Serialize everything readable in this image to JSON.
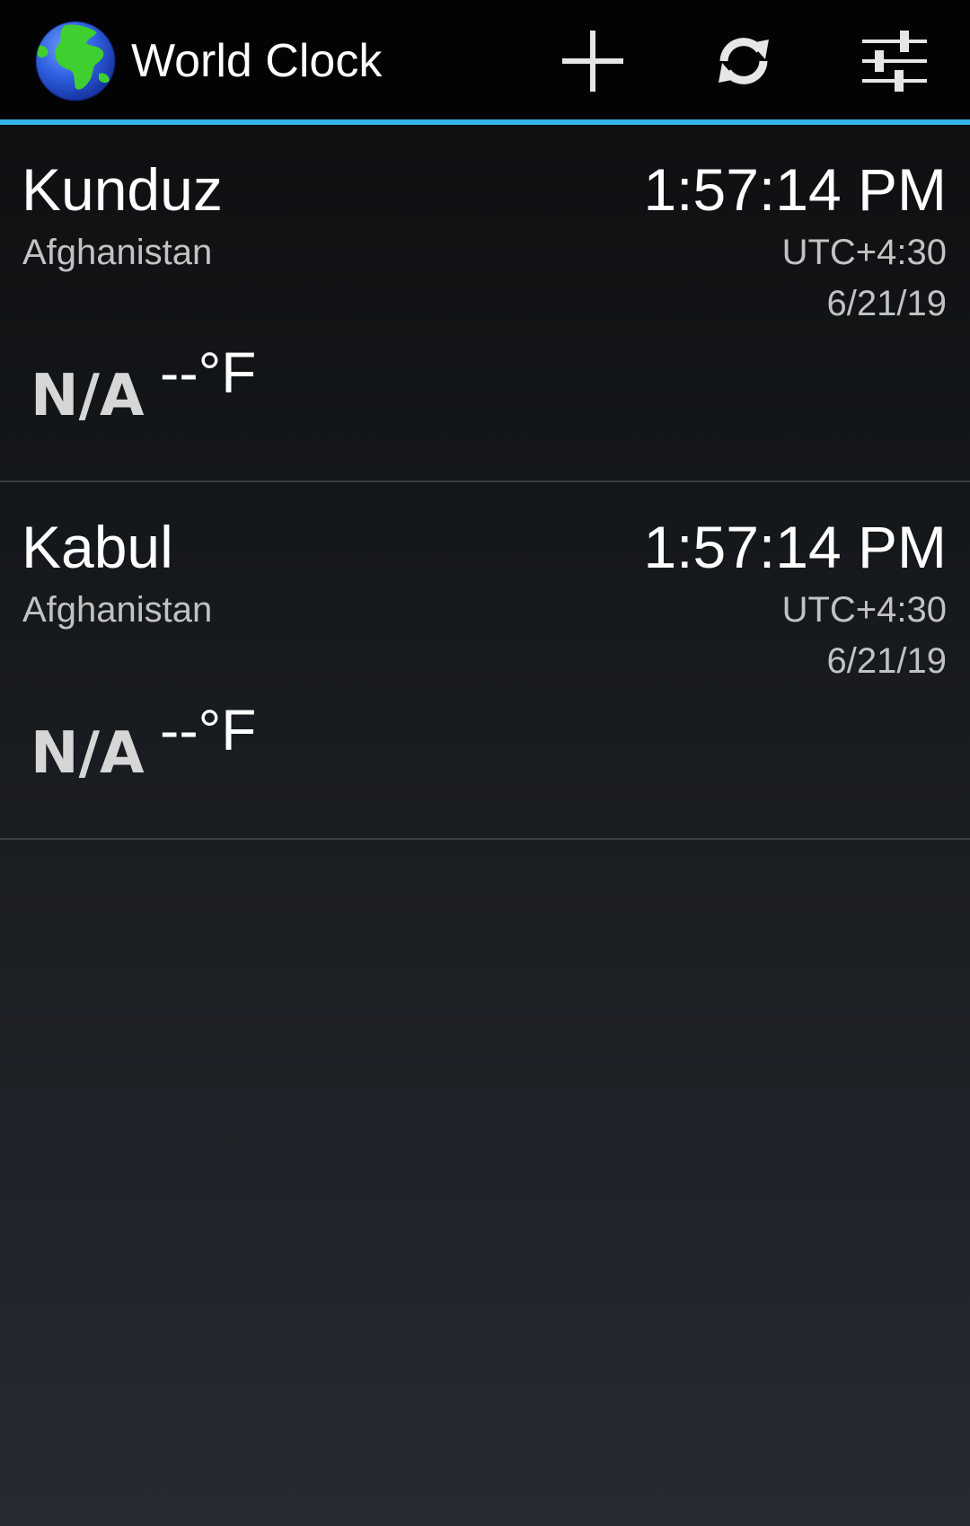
{
  "action_bar": {
    "title": "World Clock",
    "icons": {
      "app": "globe-icon",
      "add": "plus-icon",
      "refresh": "refresh-icon",
      "settings": "sliders-icon"
    }
  },
  "colors": {
    "accent": "#33b5e5",
    "action_bar_background": "#030303",
    "globe_ocean": "#2f5fe0",
    "globe_land": "#3fcf2f"
  },
  "clocks": [
    {
      "city": "Kunduz",
      "country": "Afghanistan",
      "time": "1:57:14 PM",
      "utc_offset": "UTC+4:30",
      "date": "6/21/19",
      "weather": "N/A",
      "temperature": "--°F"
    },
    {
      "city": "Kabul",
      "country": "Afghanistan",
      "time": "1:57:14 PM",
      "utc_offset": "UTC+4:30",
      "date": "6/21/19",
      "weather": "N/A",
      "temperature": "--°F"
    }
  ]
}
